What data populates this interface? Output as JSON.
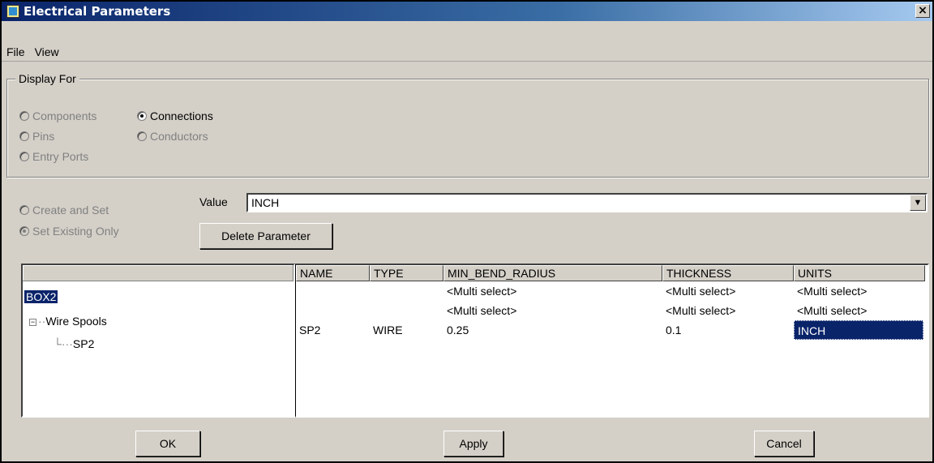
{
  "window": {
    "title": "Electrical Parameters",
    "close_glyph": "×"
  },
  "menu": [
    "File",
    "View"
  ],
  "display_for": {
    "legend": "Display For",
    "options": [
      {
        "label": "Components",
        "checked": false,
        "enabled": false
      },
      {
        "label": "Connections",
        "checked": true,
        "enabled": true
      },
      {
        "label": "Pins",
        "checked": false,
        "enabled": false
      },
      {
        "label": "Conductors",
        "checked": false,
        "enabled": false
      },
      {
        "label": "Entry Ports",
        "checked": false,
        "enabled": false
      }
    ]
  },
  "mode": {
    "create_and_set": "Create and Set",
    "set_existing_only": "Set Existing Only"
  },
  "value": {
    "label": "Value",
    "current": "INCH"
  },
  "delete_parameter": "Delete Parameter",
  "tree": {
    "root": "BOX2",
    "group": "Wire Spools",
    "child": "SP2",
    "toggle_glyph": "−"
  },
  "grid": {
    "columns": [
      "NAME",
      "TYPE",
      "MIN_BEND_RADIUS",
      "THICKNESS",
      "UNITS"
    ],
    "rows": [
      [
        "",
        "",
        "<Multi select>",
        "<Multi select>",
        "<Multi select>"
      ],
      [
        "",
        "",
        "<Multi select>",
        "<Multi select>",
        "<Multi select>"
      ],
      [
        "SP2",
        "WIRE",
        "0.25",
        "0.1",
        "INCH"
      ]
    ]
  },
  "buttons": {
    "ok": "OK",
    "apply": "Apply",
    "cancel": "Cancel"
  },
  "colors": {
    "selection": "#0a246a",
    "titlebar_start": "#0a246a",
    "titlebar_end": "#a6caf0",
    "face": "#d4d0c8"
  }
}
